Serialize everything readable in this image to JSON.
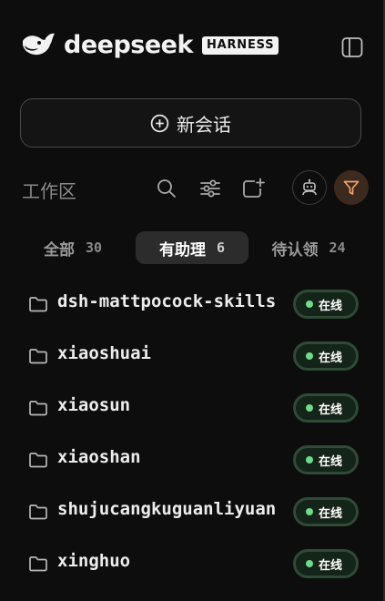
{
  "header": {
    "brand": "deepseek",
    "badge": "HARNESS",
    "sidebar_toggle_icon": "sidebar-panel-icon",
    "logo_icon": "whale-logo-icon"
  },
  "new_chat": {
    "label": "新会话",
    "icon": "plus-circle-icon"
  },
  "toolbar": {
    "workspace_label": "工作区",
    "icons": [
      "search-icon",
      "sliders-icon",
      "add-window-icon",
      "robot-icon",
      "filter-icon"
    ],
    "filter_accent": "#f0a070"
  },
  "tabs": [
    {
      "label": "全部",
      "count": "30",
      "active": false
    },
    {
      "label": "有助理",
      "count": "6",
      "active": true
    },
    {
      "label": "待认领",
      "count": "24",
      "active": false
    }
  ],
  "items": [
    {
      "name": "dsh-mattpocock-skills",
      "status": "在线"
    },
    {
      "name": "xiaoshuai",
      "status": "在线"
    },
    {
      "name": "xiaosun",
      "status": "在线"
    },
    {
      "name": "xiaoshan",
      "status": "在线"
    },
    {
      "name": "shujucangkuguanliyuan",
      "status": "在线"
    },
    {
      "name": "xinghuo",
      "status": "在线"
    }
  ],
  "colors": {
    "background": "#0d0d0d",
    "online_dot": "#6fdc8c",
    "online_border": "#2f4a35"
  }
}
